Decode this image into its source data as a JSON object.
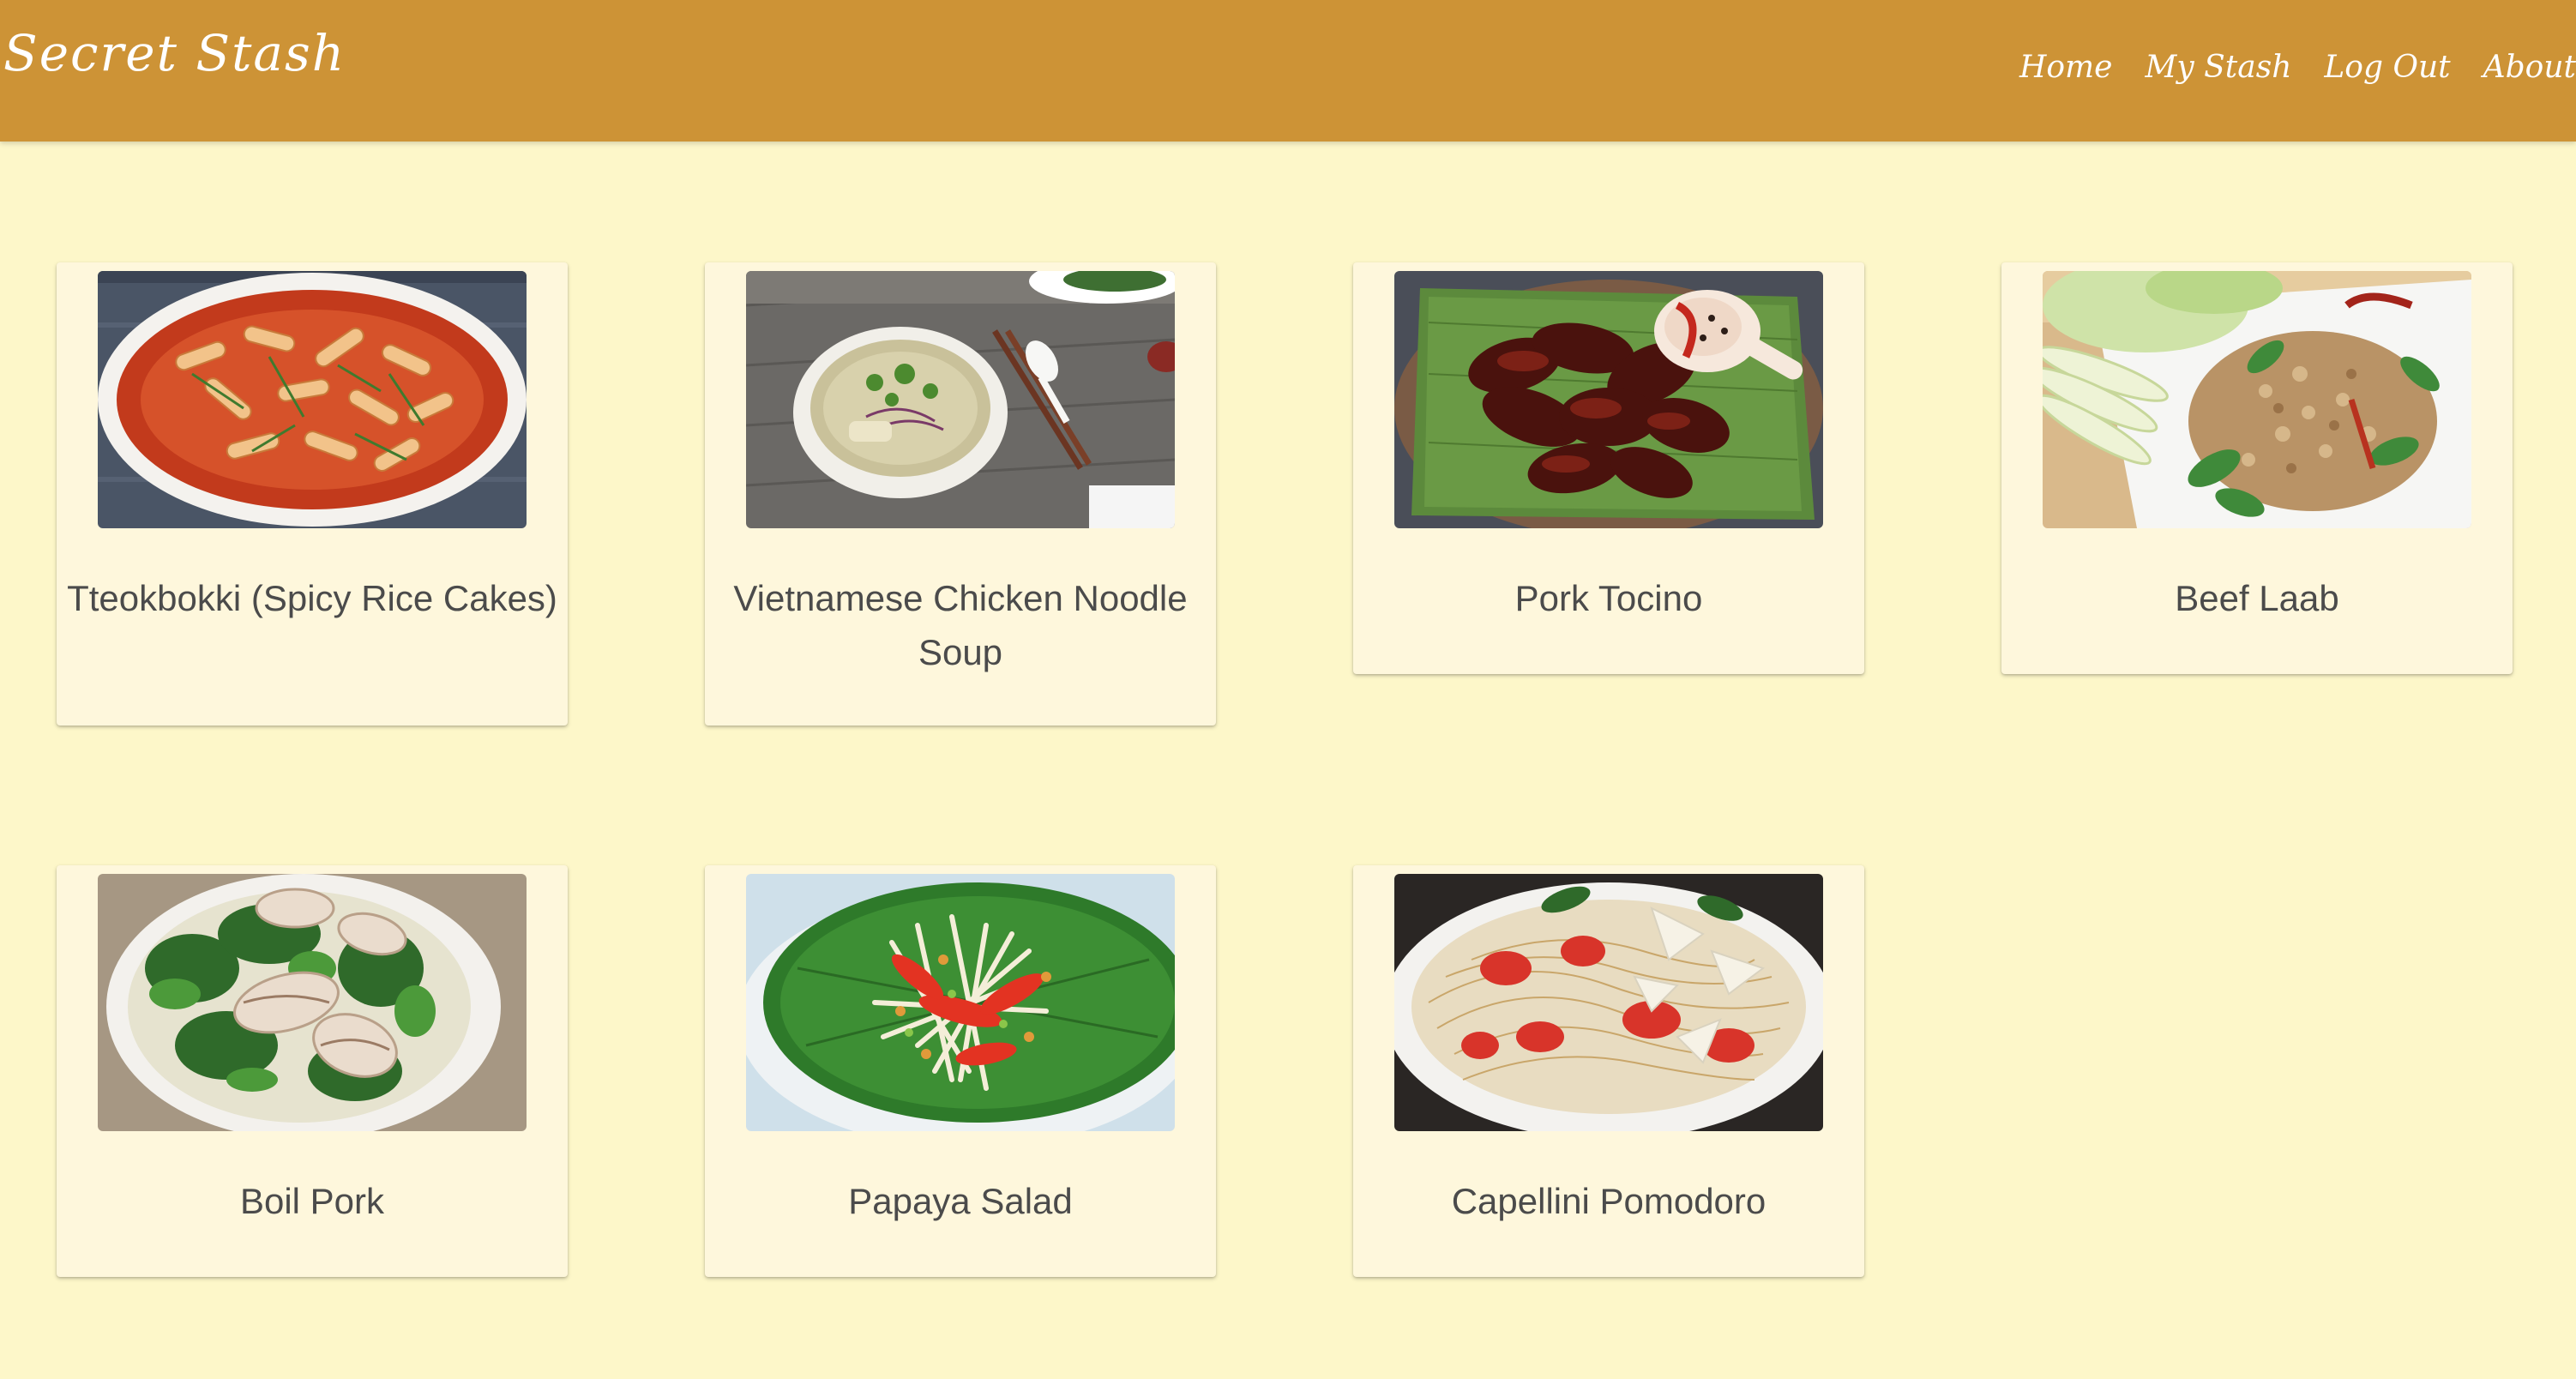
{
  "navbar": {
    "brand": "Secret Stash",
    "links": [
      "Home",
      "My Stash",
      "Log Out",
      "About"
    ]
  },
  "recipes": [
    {
      "title": "Tteokbokki (Spicy Rice Cakes)",
      "image": "tteokbokki-photo"
    },
    {
      "title": "Vietnamese Chicken Noodle Soup",
      "image": "chicken-noodle-soup-photo"
    },
    {
      "title": "Pork Tocino",
      "image": "pork-tocino-photo"
    },
    {
      "title": "Beef Laab",
      "image": "beef-laab-photo"
    },
    {
      "title": "Boil Pork",
      "image": "boil-pork-photo"
    },
    {
      "title": "Papaya Salad",
      "image": "papaya-salad-photo"
    },
    {
      "title": "Capellini Pomodoro",
      "image": "capellini-pomodoro-photo"
    }
  ],
  "colors": {
    "navbar": "#cd9336",
    "page_background": "#fdf7c9",
    "card_background": "#fef7dc",
    "card_text": "#4b4b4b"
  }
}
